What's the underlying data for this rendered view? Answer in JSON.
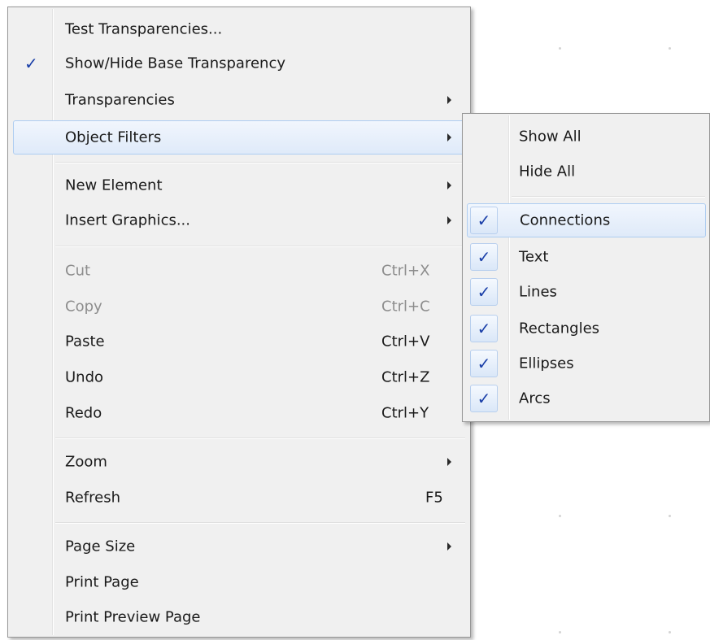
{
  "main_menu": {
    "items": [
      {
        "label": "Test Transparencies...",
        "checked": false,
        "submenu": false,
        "shortcut": ""
      },
      {
        "label": "Show/Hide Base Transparency",
        "checked": true,
        "submenu": false,
        "shortcut": ""
      },
      {
        "label": "Transparencies",
        "checked": false,
        "submenu": true,
        "shortcut": ""
      },
      {
        "label": "Object Filters",
        "checked": false,
        "submenu": true,
        "shortcut": "",
        "highlighted": true
      },
      {
        "label": "New Element",
        "checked": false,
        "submenu": true,
        "shortcut": ""
      },
      {
        "label": "Insert Graphics...",
        "checked": false,
        "submenu": true,
        "shortcut": ""
      },
      {
        "label": "Cut",
        "checked": false,
        "submenu": false,
        "shortcut": "Ctrl+X",
        "disabled": true
      },
      {
        "label": "Copy",
        "checked": false,
        "submenu": false,
        "shortcut": "Ctrl+C",
        "disabled": true
      },
      {
        "label": "Paste",
        "checked": false,
        "submenu": false,
        "shortcut": "Ctrl+V"
      },
      {
        "label": "Undo",
        "checked": false,
        "submenu": false,
        "shortcut": "Ctrl+Z"
      },
      {
        "label": "Redo",
        "checked": false,
        "submenu": false,
        "shortcut": "Ctrl+Y"
      },
      {
        "label": "Zoom",
        "checked": false,
        "submenu": true,
        "shortcut": ""
      },
      {
        "label": "Refresh",
        "checked": false,
        "submenu": false,
        "shortcut": "F5"
      },
      {
        "label": "Page Size",
        "checked": false,
        "submenu": true,
        "shortcut": ""
      },
      {
        "label": "Print Page",
        "checked": false,
        "submenu": false,
        "shortcut": ""
      },
      {
        "label": "Print Preview Page",
        "checked": false,
        "submenu": false,
        "shortcut": ""
      }
    ]
  },
  "object_filters_submenu": {
    "items": [
      {
        "label": "Show All",
        "checked": false
      },
      {
        "label": "Hide All",
        "checked": false
      },
      {
        "label": "Connections",
        "checked": true,
        "highlighted": true
      },
      {
        "label": "Text",
        "checked": true
      },
      {
        "label": "Lines",
        "checked": true
      },
      {
        "label": "Rectangles",
        "checked": true
      },
      {
        "label": "Ellipses",
        "checked": true
      },
      {
        "label": "Arcs",
        "checked": true
      }
    ]
  },
  "check_glyph": "✓",
  "colors": {
    "menu_bg": "#f0f0f0",
    "highlight": "#dfeaf9",
    "check": "#1a3fa8",
    "disabled_text": "#8d8d8d"
  }
}
